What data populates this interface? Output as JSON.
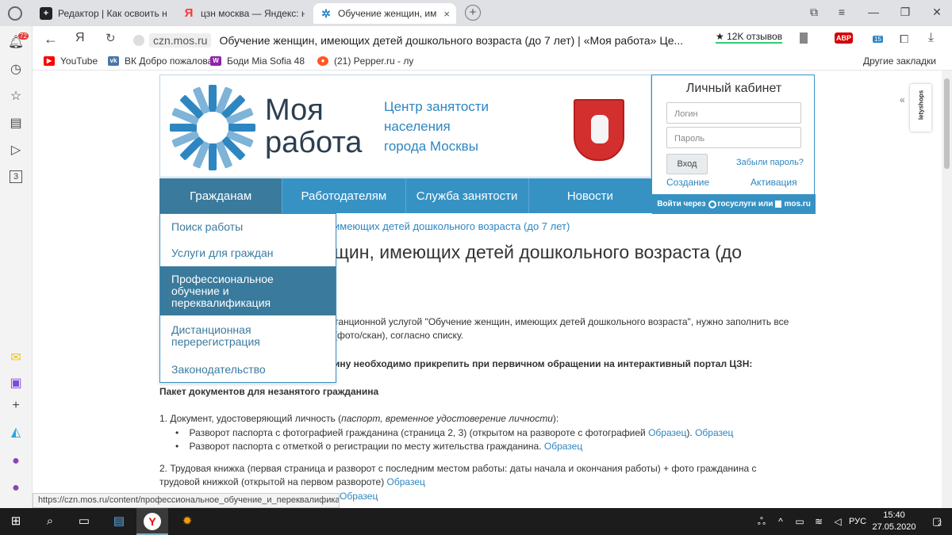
{
  "browser": {
    "tabs": [
      {
        "title": "Редактор | Как освоить нс",
        "icon": "editor-plus-icon"
      },
      {
        "title": "цзн москва — Яндекс: наi",
        "icon": "yandex-icon"
      },
      {
        "title": "Обучение женщин, им",
        "icon": "snowflake-icon"
      }
    ],
    "address": {
      "domain": "czn.mos.ru",
      "page_title": "Обучение женщин, имеющих детей дошкольного возраста (до 7 лет) | «Моя работа» Це..."
    },
    "reviews_badge": "★ 12K отзывов",
    "abp_label": "ABP",
    "ext_badge": "15",
    "notif_count": "72",
    "bookmarks": [
      {
        "label": "YouTube",
        "color": "#ff0000"
      },
      {
        "label": "ВК Добро пожаловат",
        "color": "#4a76a8"
      },
      {
        "label": "Боди Mia Sofia 48",
        "color": "#8e24aa"
      },
      {
        "label": "(21) Pepper.ru - лу",
        "color": "#ff5722"
      }
    ],
    "other_bookmarks": "Другие закладки",
    "letyshops": "letyshops"
  },
  "site": {
    "brand_line1": "Моя",
    "brand_line2": "работа",
    "czn_line1": "Центр занятости",
    "czn_line2": "населения",
    "czn_line3": "города Москвы",
    "nav": [
      "Гражданам",
      "Работодателям",
      "Служба занятости",
      "Новости"
    ],
    "login": {
      "title": "Личный кабинет",
      "login_placeholder": "Логин",
      "password_placeholder": "Пароль",
      "submit": "Вход",
      "forgot": "Забыли пароль?",
      "create": "Создание",
      "activate": "Активация",
      "gos_prefix": "Войти через",
      "gos_mid": "госуслуги или",
      "gos_suffix": "mos.ru"
    },
    "dropdown": [
      "Поиск работы",
      "Услуги для граждан",
      "Профессиональное обучение и переквалификация",
      "Дистанционная перерегистрация",
      "Законодательство"
    ],
    "breadcrumb": "имеющих детей дошкольного возраста (до 7 лет)",
    "heading": "щин, имеющих детей дошкольного возраста (до",
    "intro1": "танционной услугой \"Обучение женщин, имеющих детей дошкольного возраста\", нужно заполнить все",
    "intro2": "(фото/скан), согласно списку.",
    "bold_note": "ину необходимо прикрепить при первичном обращении на интерактивный портал ЦЗН:",
    "package_title": "Пакет документов для незанятого гражданина",
    "item1": "1. Документ, удостоверяющий личность (",
    "item1_italic": "паспорт, временное удостоверение личности",
    "item1_end": "):",
    "bullet1": "Разворот паспорта с фотографией гражданина (страница 2, 3) (открытом на развороте с фотографией ",
    "bullet1_link": "Образец",
    "bullet1_end": "). ",
    "bullet1_link2": "Образец",
    "bullet2": "Разворот паспорта с отметкой о регистрации по месту жительства гражданина. ",
    "bullet2_link": "Образец",
    "item2": "2. Трудовая книжка (первая страница и разворот с последним местом работы: даты начала и окончания работы) + фото гражданина с",
    "item2b": "трудовой книжкой (открытой на первом развороте) ",
    "item2_link": "Образец",
    "item3_link": "Образец"
  },
  "status_url": "https://czn.mos.ru/content/профессиональное_обучение_и_переквалификация",
  "taskbar": {
    "lang": "РУС",
    "time": "15:40",
    "date": "27.05.2020",
    "notif": "2"
  }
}
